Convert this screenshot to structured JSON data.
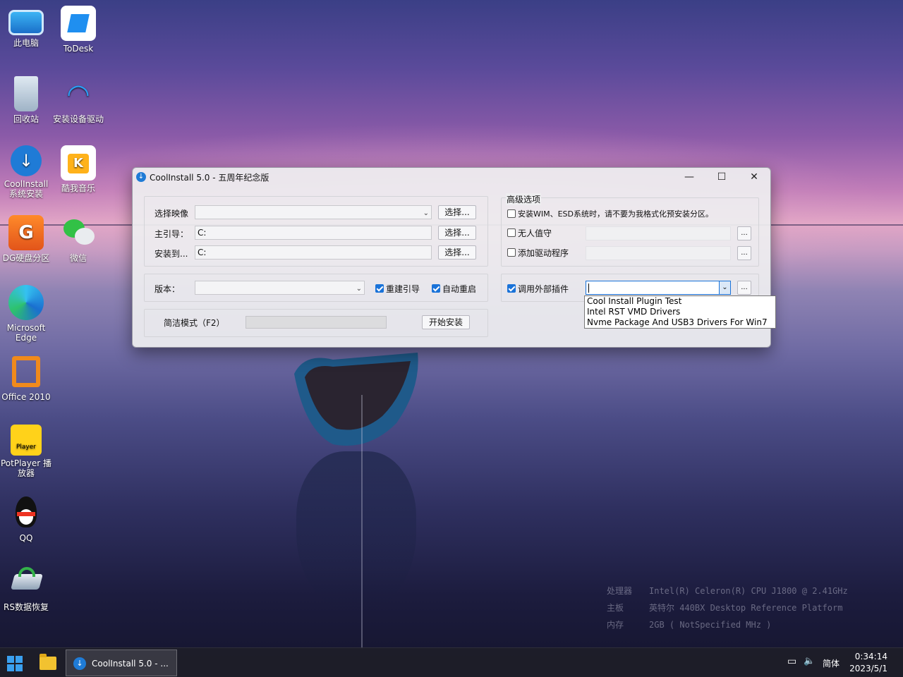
{
  "desktop_icons": [
    {
      "label": "此电脑",
      "icon": "computer-icon"
    },
    {
      "label": "ToDesk",
      "icon": "todesk-icon"
    },
    {
      "label": "回收站",
      "icon": "recycle-bin-icon"
    },
    {
      "label": "安装设备驱动",
      "icon": "wifi-driver-icon"
    },
    {
      "label": "CoolInstall 系统安装",
      "icon": "coolinstall-icon"
    },
    {
      "label": "酷我音乐",
      "icon": "kuwo-music-icon"
    },
    {
      "label": "DG硬盘分区",
      "icon": "diskgenius-icon"
    },
    {
      "label": "微信",
      "icon": "wechat-icon"
    },
    {
      "label": "Microsoft Edge",
      "icon": "edge-icon"
    },
    {
      "label": "Office 2010",
      "icon": "office-icon"
    },
    {
      "label": "PotPlayer 播放器",
      "icon": "potplayer-icon"
    },
    {
      "label": "QQ",
      "icon": "qq-icon"
    },
    {
      "label": "RS数据恢复",
      "icon": "rs-recovery-icon"
    }
  ],
  "window": {
    "title": "CoolInstall 5.0 - 五周年纪念版",
    "left": {
      "image_label": "选择映像",
      "image_value": "",
      "boot_label": "主引导：",
      "boot_value": "C:",
      "install_label": "安装到...",
      "install_value": "C:",
      "choose_btn": "选择...",
      "version_label": "版本：",
      "version_value": "",
      "rebuild_boot": "重建引导",
      "rebuild_boot_checked": true,
      "auto_restart": "自动重启",
      "auto_restart_checked": true,
      "simple_mode": "简洁模式（F2）",
      "start_btn": "开始安装"
    },
    "advanced": {
      "title": "高级选项",
      "wim_option": "安装WIM、ESD系统时，请不要为我格式化预安装分区。",
      "unattended": "无人值守",
      "add_drivers": "添加驱动程序",
      "external_plugin": "调用外部插件",
      "external_plugin_checked": true,
      "browse_btn": "...",
      "plugin_options": [
        "Cool Install Plugin Test",
        "Intel RST VMD Drivers",
        "Nvme Package And USB3 Drivers For Win7"
      ]
    }
  },
  "sysinfo": {
    "cpu_key": "处理器",
    "cpu_val": "Intel(R) Celeron(R) CPU  J1800  @ 2.41GHz",
    "board_key": "主板",
    "board_val": "英特尔 440BX Desktop Reference Platform",
    "mem_key": "内存",
    "mem_val": "2GB ( NotSpecified  MHz )"
  },
  "taskbar": {
    "app_label": "CoolInstall 5.0 - ...",
    "ime": "简体",
    "time": "0:34:14",
    "date": "2023/5/1"
  },
  "colors": {
    "accent": "#1a73d9",
    "window_bg": "#eeeef0"
  }
}
